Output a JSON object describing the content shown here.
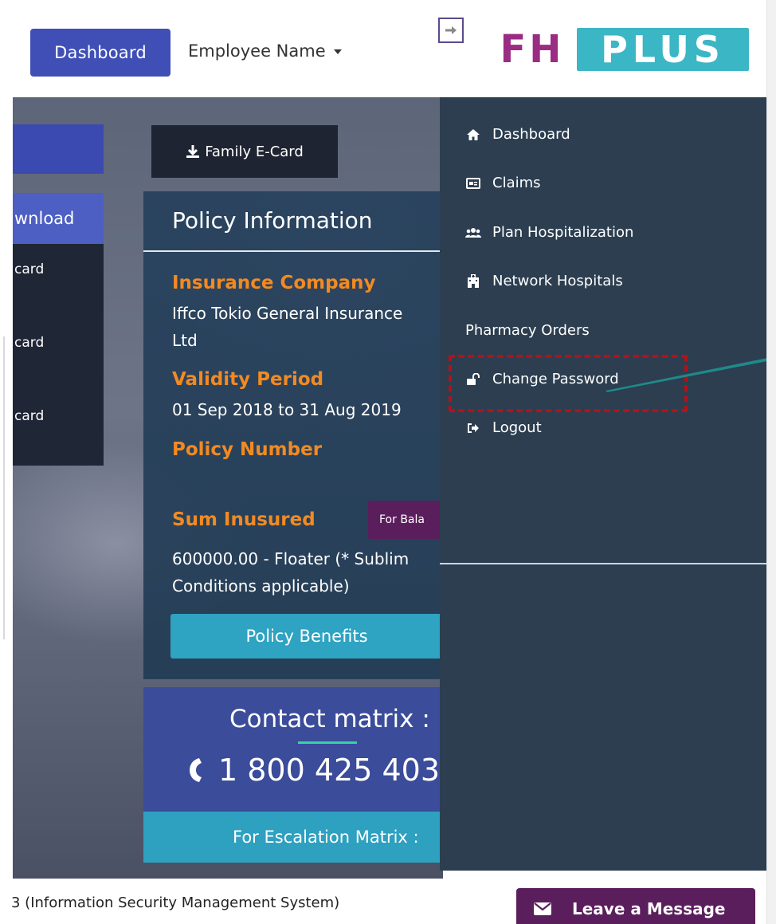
{
  "header": {
    "dashboard_button": "Dashboard",
    "employee_name": "Employee Name",
    "logo_left": "FH",
    "logo_right": "PLUS"
  },
  "sidebar": {
    "download_label": "wnload",
    "items": [
      "card",
      "card",
      "card"
    ]
  },
  "main": {
    "family_ecard_label": "Family E-Card",
    "policy": {
      "title": "Policy Information",
      "insurance_company_label": "Insurance Company",
      "insurance_company_line1": "Iffco Tokio General Insurance",
      "insurance_company_line2": "Ltd",
      "validity_label": "Validity Period",
      "validity_value": "01 Sep 2018 to 31 Aug 2019",
      "policy_number_label": "Policy Number",
      "sum_insured_label": "Sum Inusured",
      "balance_button": "For Bala",
      "sum_insured_line1": "600000.00 - Floater (* Sublim",
      "sum_insured_line2": "Conditions applicable)",
      "benefits_button": "Policy Benefits"
    },
    "contact": {
      "title": "Contact matrix :",
      "phone": "1 800 425 403",
      "escalation_button": "For Escalation Matrix :"
    }
  },
  "footer": {
    "text": "3 (Information Security Management System)",
    "leave_message": "Leave a Message"
  },
  "menu": {
    "items": [
      {
        "label": "Dashboard",
        "icon": "home-icon"
      },
      {
        "label": "Claims",
        "icon": "card-icon"
      },
      {
        "label": "Plan Hospitalization",
        "icon": "users-icon"
      },
      {
        "label": "Network Hospitals",
        "icon": "hospital-icon"
      },
      {
        "label": "Pharmacy Orders",
        "icon": ""
      },
      {
        "label": "Change Password",
        "icon": "unlock-icon"
      },
      {
        "label": "Logout",
        "icon": "logout-icon"
      }
    ]
  },
  "colors": {
    "primary_button": "#3f4fb6",
    "menu_background": "#2c3e50",
    "accent_orange": "#f28a22",
    "teal": "#2ea3c2",
    "highlight": "#b31217",
    "brand_purple": "#9a2c84",
    "brand_teal": "#3bb6c4"
  }
}
